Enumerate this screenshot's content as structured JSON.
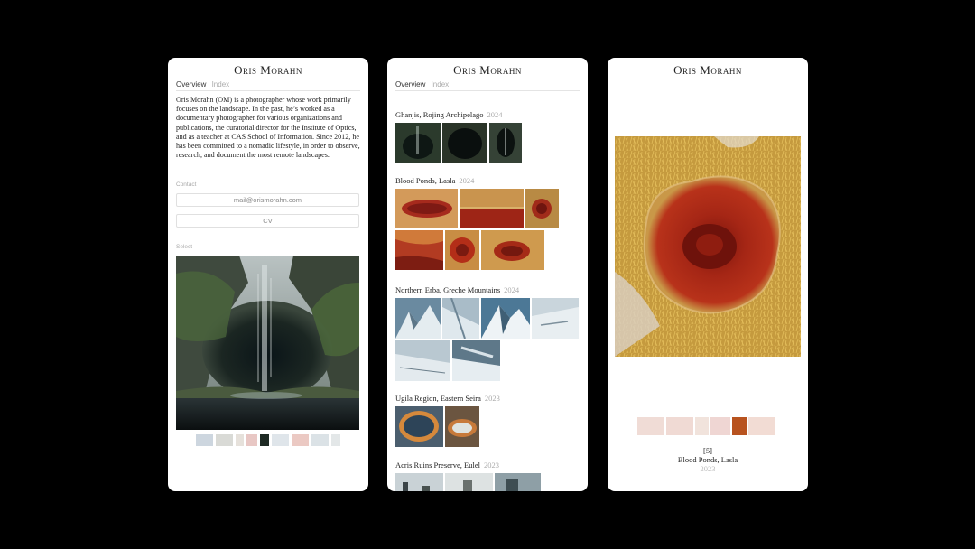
{
  "site": {
    "title": "Oris Morahn",
    "tabs": [
      {
        "label": "Overview"
      },
      {
        "label": "Index"
      }
    ]
  },
  "overview": {
    "bio": "Oris Morahn (OM) is a photographer whose work primarily focuses on the landscape. In the past, he’s worked as a documentary photographer for various organizations and publications, the curatorial director for the Institute of Optics, and as a teacher at CAS School of Information. Since 2012, he has been committed to a nomadic lifestyle, in order to observe, research, and document the most remote landscapes.",
    "contact_label": "Contact",
    "email": "mail@orismorahn.com",
    "cv_label": "CV",
    "select_label": "Select"
  },
  "series": [
    {
      "title": "Ghanjis, Rojing Archipelago",
      "year": "2024"
    },
    {
      "title": "Blood Ponds, Lasla",
      "year": "2024"
    },
    {
      "title": "Northern Erba, Greche Mountains",
      "year": "2024"
    },
    {
      "title": "Ugila Region, Eastern Seira",
      "year": "2023"
    },
    {
      "title": "Acris Ruins Preserve, Eulel",
      "year": "2023"
    }
  ],
  "detail": {
    "index": "[5]",
    "title": "Blood Ponds, Lasla",
    "year": "2023"
  }
}
